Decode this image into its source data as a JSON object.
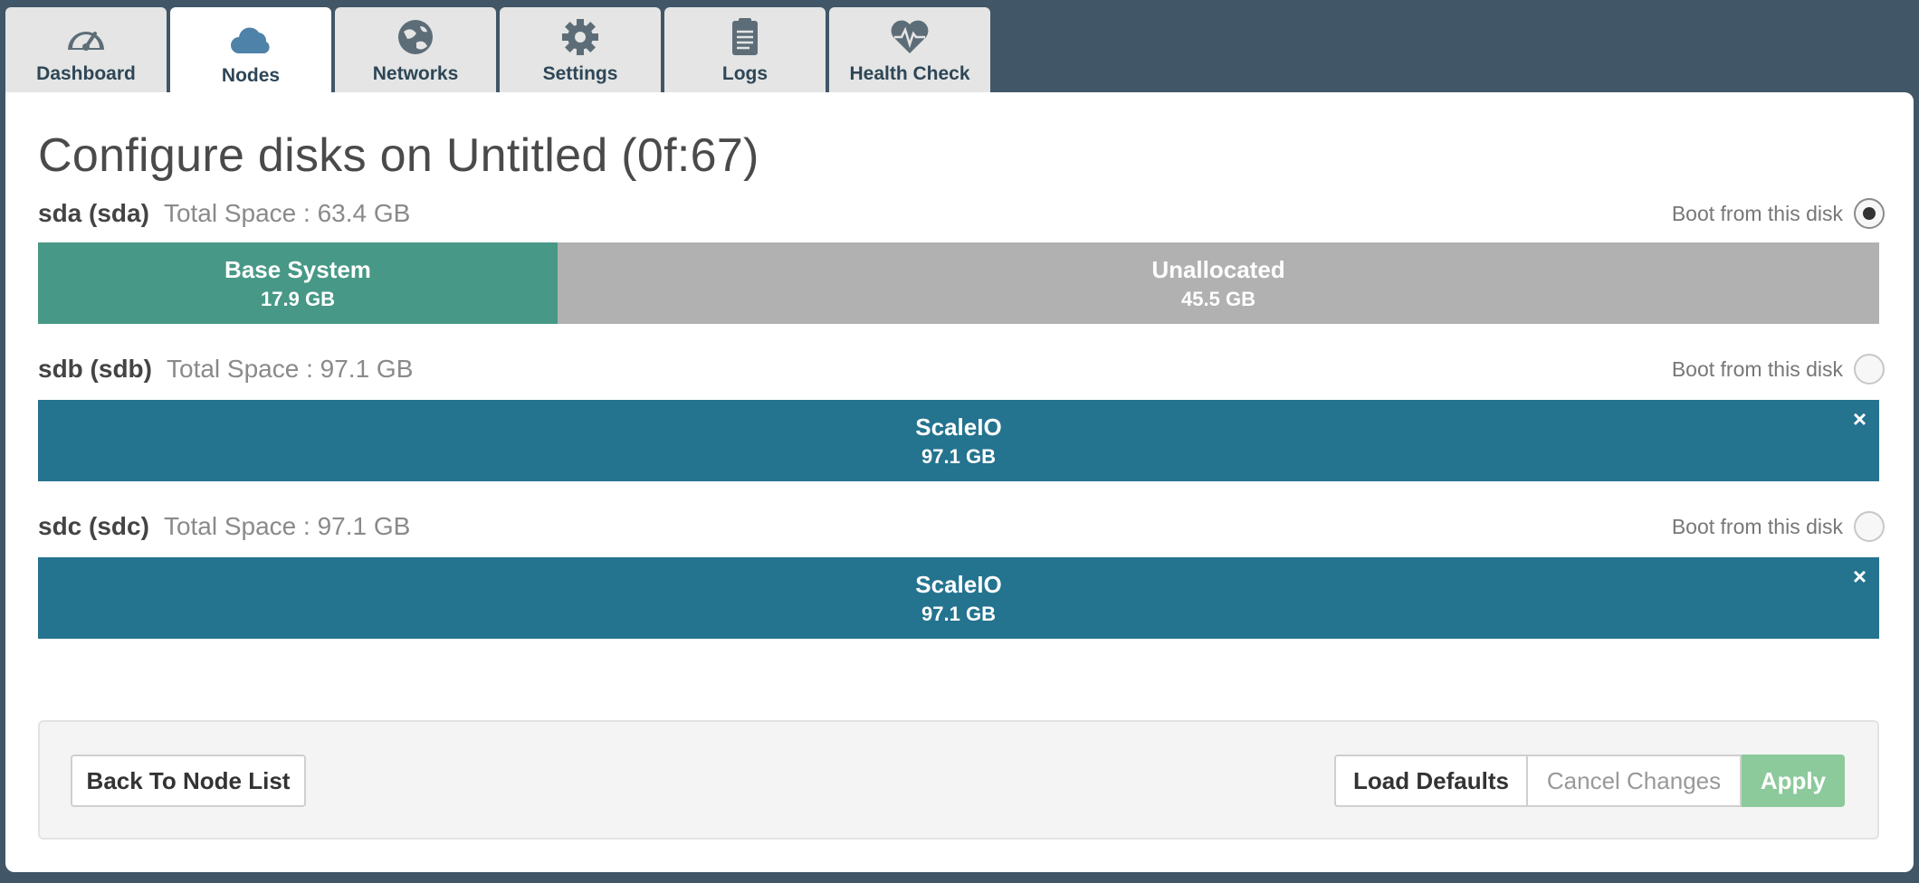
{
  "tabs": [
    {
      "label": "Dashboard",
      "icon": "dashboard-gauge-icon"
    },
    {
      "label": "Nodes",
      "icon": "cloud-icon",
      "active": true
    },
    {
      "label": "Networks",
      "icon": "globe-network-icon"
    },
    {
      "label": "Settings",
      "icon": "gear-icon"
    },
    {
      "label": "Logs",
      "icon": "clipboard-icon"
    },
    {
      "label": "Health Check",
      "icon": "heart-pulse-icon"
    }
  ],
  "page": {
    "title": "Configure disks on Untitled (0f:67)"
  },
  "disks": [
    {
      "name": "sda (sda)",
      "total_space": "Total Space : 63.4 GB",
      "boot_label": "Boot from this disk",
      "boot_selected": true,
      "segments": [
        {
          "label": "Base System",
          "size": "17.9 GB",
          "share": 0.282
        },
        {
          "label": "Unallocated",
          "size": "45.5 GB",
          "share": 0.718
        }
      ]
    },
    {
      "name": "sdb (sdb)",
      "total_space": "Total Space : 97.1 GB",
      "boot_label": "Boot from this disk",
      "boot_selected": false,
      "segments": [
        {
          "label": "ScaleIO",
          "size": "97.1 GB",
          "share": 1.0,
          "remove_glyph": "×"
        }
      ]
    },
    {
      "name": "sdc (sdc)",
      "total_space": "Total Space : 97.1 GB",
      "boot_label": "Boot from this disk",
      "boot_selected": false,
      "segments": [
        {
          "label": "ScaleIO",
          "size": "97.1 GB",
          "share": 1.0,
          "remove_glyph": "×"
        }
      ]
    }
  ],
  "footer": {
    "back_label": "Back To Node List",
    "load_defaults_label": "Load Defaults",
    "cancel_label": "Cancel Changes",
    "apply_label": "Apply"
  },
  "colors": {
    "background": "#415667",
    "base_system": "#479886",
    "unallocated": "#b0b1b0",
    "scaleio": "#24738f",
    "apply_disabled": "#8cc99b",
    "tab_text": "#2e4657"
  }
}
